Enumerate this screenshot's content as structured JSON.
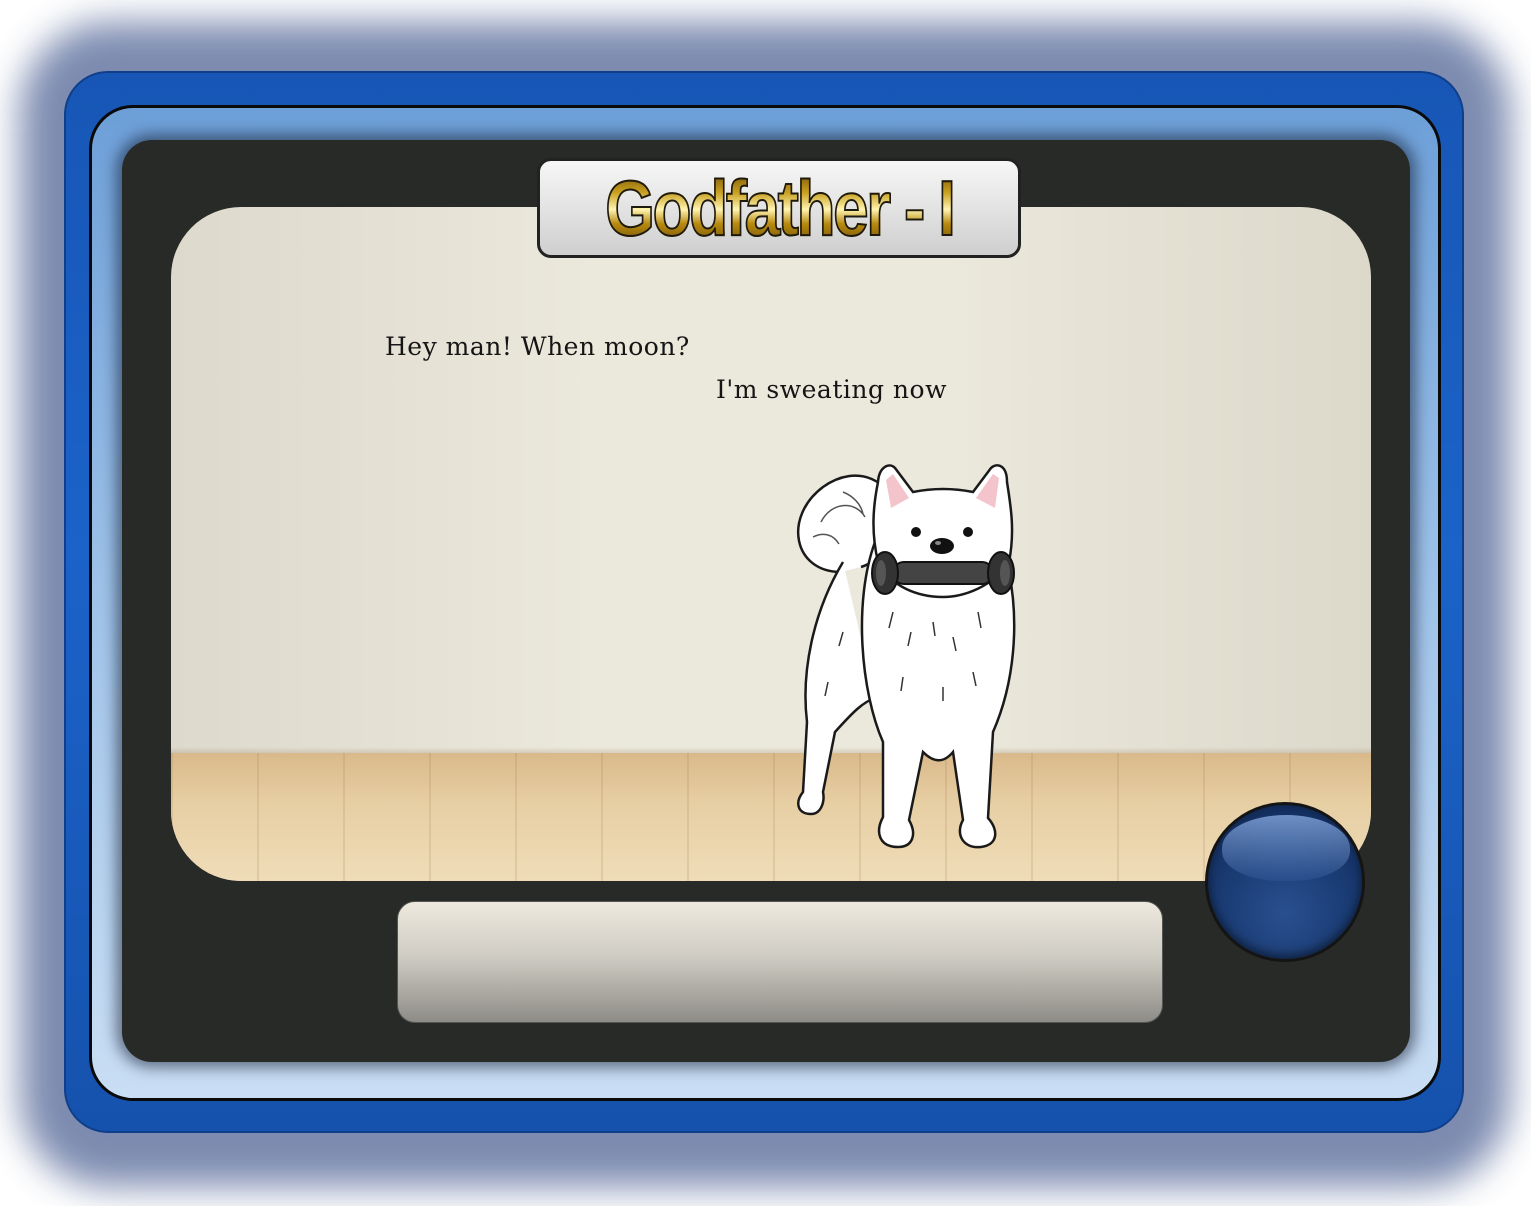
{
  "game": {
    "title": "Godfather - I",
    "dialog": {
      "line_1": "Hey man! When moon?",
      "line_2": "I'm sweating now"
    },
    "text_box": "",
    "character": "white-dog-with-dumbbell",
    "action_button_icon": "blue-orb-icon"
  },
  "colors": {
    "frame_blue": "#1b63c9",
    "panel_dark": "#272a26",
    "wall": "#ebe8dc",
    "floor": "#e7cfa4",
    "title_gold": "#c9a020",
    "orb_blue": "#1b3d76"
  }
}
